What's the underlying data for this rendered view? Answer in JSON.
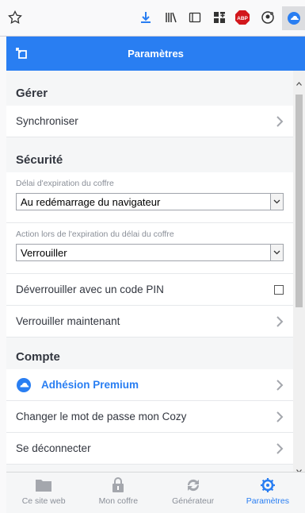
{
  "browser": {
    "icons": [
      "star-icon",
      "download-icon",
      "library-icon",
      "reader-icon",
      "extensions-icon",
      "adblock-icon",
      "account-icon",
      "cozy-icon"
    ],
    "adblock_label": "ABP"
  },
  "header": {
    "title": "Paramètres"
  },
  "sections": {
    "manage": {
      "title": "Gérer",
      "sync_label": "Synchroniser"
    },
    "security": {
      "title": "Sécurité",
      "timeout_label": "Délai d'expiration du coffre",
      "timeout_value": "Au redémarrage du navigateur",
      "action_label": "Action lors de l'expiration du délai du coffre",
      "action_value": "Verrouiller",
      "pin_label": "Déverrouiller avec un code PIN",
      "lock_now_label": "Verrouiller maintenant"
    },
    "account": {
      "title": "Compte",
      "premium_label": "Adhésion Premium",
      "change_password_label": "Changer le mot de passe mon Cozy",
      "logout_label": "Se déconnecter"
    }
  },
  "tabs": [
    {
      "label": "Ce site web"
    },
    {
      "label": "Mon coffre"
    },
    {
      "label": "Générateur"
    },
    {
      "label": "Paramètres"
    }
  ],
  "colors": {
    "accent": "#297ef2",
    "text": "#32363f",
    "muted": "#8a8f98"
  }
}
